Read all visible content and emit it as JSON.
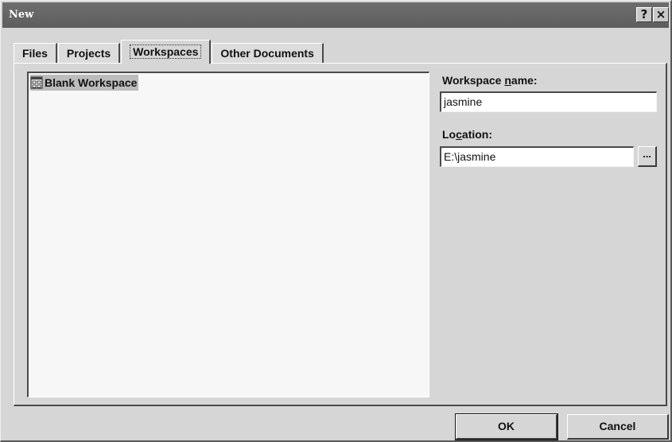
{
  "window": {
    "title": "New",
    "help_label": "?",
    "close_label": "×"
  },
  "tabs": [
    {
      "label": "Files",
      "active": false
    },
    {
      "label": "Projects",
      "active": false
    },
    {
      "label": "Workspaces",
      "active": true
    },
    {
      "label": "Other Documents",
      "active": false
    }
  ],
  "workspace_types": [
    {
      "label": "Blank Workspace",
      "selected": true,
      "icon": "workspace-icon"
    }
  ],
  "workspace_name": {
    "label_pre": "Workspace ",
    "label_hotkey": "n",
    "label_post": "ame:",
    "value": "jasmine"
  },
  "location": {
    "label_pre": "Lo",
    "label_hotkey": "c",
    "label_post": "ation:",
    "value": "E:\\jasmine",
    "browse_label": "..."
  },
  "buttons": {
    "ok": "OK",
    "cancel": "Cancel"
  },
  "colors": {
    "titlebar": "#5e5e5e",
    "dialog_face": "#d6d6d6",
    "selection": "#bcbcbc"
  }
}
